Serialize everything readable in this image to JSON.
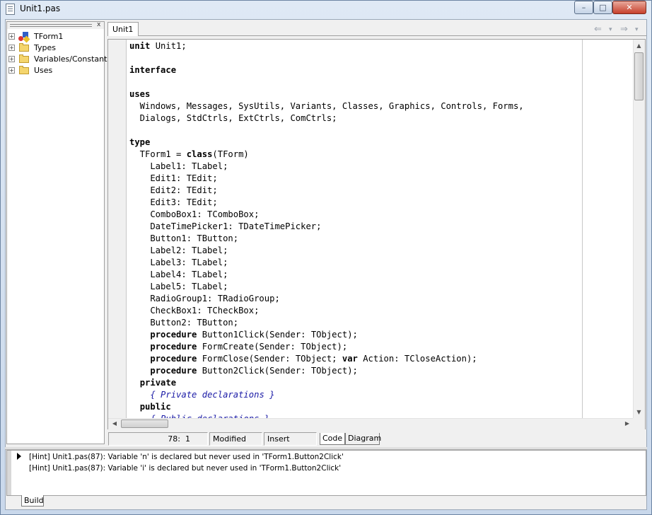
{
  "window": {
    "title": "Unit1.pas",
    "controls": {
      "minimize": "–",
      "maximize": "□",
      "close": "✕"
    }
  },
  "structure_tree": {
    "close_glyph": "x",
    "items": [
      {
        "label": "TForm1",
        "icon": "form-icon"
      },
      {
        "label": "Types",
        "icon": "folder-icon"
      },
      {
        "label": "Variables/Constants",
        "icon": "folder-icon"
      },
      {
        "label": "Uses",
        "icon": "folder-icon"
      }
    ]
  },
  "editor": {
    "tab": "Unit1",
    "nav": {
      "back": "⇐",
      "back_drop": "▾",
      "forward": "⇒",
      "forward_drop": "▾"
    },
    "code_lines": [
      "unit Unit1;",
      "",
      "interface",
      "",
      "uses",
      "  Windows, Messages, SysUtils, Variants, Classes, Graphics, Controls, Forms,",
      "  Dialogs, StdCtrls, ExtCtrls, ComCtrls;",
      "",
      "type",
      "  TForm1 = class(TForm)",
      "    Label1: TLabel;",
      "    Edit1: TEdit;",
      "    Edit2: TEdit;",
      "    Edit3: TEdit;",
      "    ComboBox1: TComboBox;",
      "    DateTimePicker1: TDateTimePicker;",
      "    Button1: TButton;",
      "    Label2: TLabel;",
      "    Label3: TLabel;",
      "    Label4: TLabel;",
      "    Label5: TLabel;",
      "    RadioGroup1: TRadioGroup;",
      "    CheckBox1: TCheckBox;",
      "    Button2: TButton;",
      "    procedure Button1Click(Sender: TObject);",
      "    procedure FormCreate(Sender: TObject);",
      "    procedure FormClose(Sender: TObject; var Action: TCloseAction);",
      "    procedure Button2Click(Sender: TObject);",
      "  private",
      "    { Private declarations }",
      "  public",
      "    { Public declarations }"
    ],
    "keywords": [
      "unit",
      "interface",
      "uses",
      "type",
      "class",
      "procedure",
      "var",
      "private",
      "public"
    ]
  },
  "status": {
    "line": "78",
    "column": "1",
    "modified": "Modified",
    "mode": "Insert",
    "tabs": [
      "Code",
      "Diagram"
    ]
  },
  "messages": {
    "items": [
      "[Hint] Unit1.pas(87): Variable 'n' is declared but never used in 'TForm1.Button2Click'",
      "[Hint] Unit1.pas(87): Variable 'i' is declared but never used in 'TForm1.Button2Click'"
    ],
    "tab": "Build"
  }
}
